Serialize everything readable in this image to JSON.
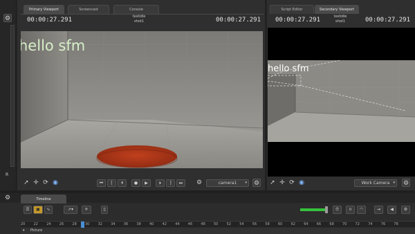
{
  "primary": {
    "tabs": [
      "Primary Viewport",
      "Screencast",
      "Console"
    ],
    "timecode_left": "00:00:27.291",
    "timecode_right": "00:00:27.291",
    "session": "testidle",
    "shot": "shot1",
    "overlay_text": "hello sfm",
    "camera_select": "camera1"
  },
  "secondary": {
    "tabs": [
      "Script Editor",
      "Secondary Viewport"
    ],
    "timecode_left": "00:00:27.291",
    "timecode_right": "00:00:27.291",
    "session": "testidle",
    "shot": "shot1",
    "overlay_text": "hello sfm",
    "camera_select": "Work Camera"
  },
  "left_panel": {
    "letter": "R"
  },
  "timeline": {
    "tab": "Timeline",
    "track": "Picture",
    "ruler": [
      "20",
      "22",
      "24",
      "26",
      "28",
      "30",
      "32",
      "34",
      "36",
      "38",
      "40",
      "42",
      "44",
      "46",
      "48",
      "50",
      "52",
      "54",
      "56",
      "58",
      "60",
      "62",
      "64",
      "66",
      "68",
      "70",
      "72",
      "74",
      "76",
      "78"
    ]
  },
  "colors": {
    "accent_green": "#36c23c",
    "playhead": "#4a8fd6",
    "disc": "#b4341a"
  }
}
